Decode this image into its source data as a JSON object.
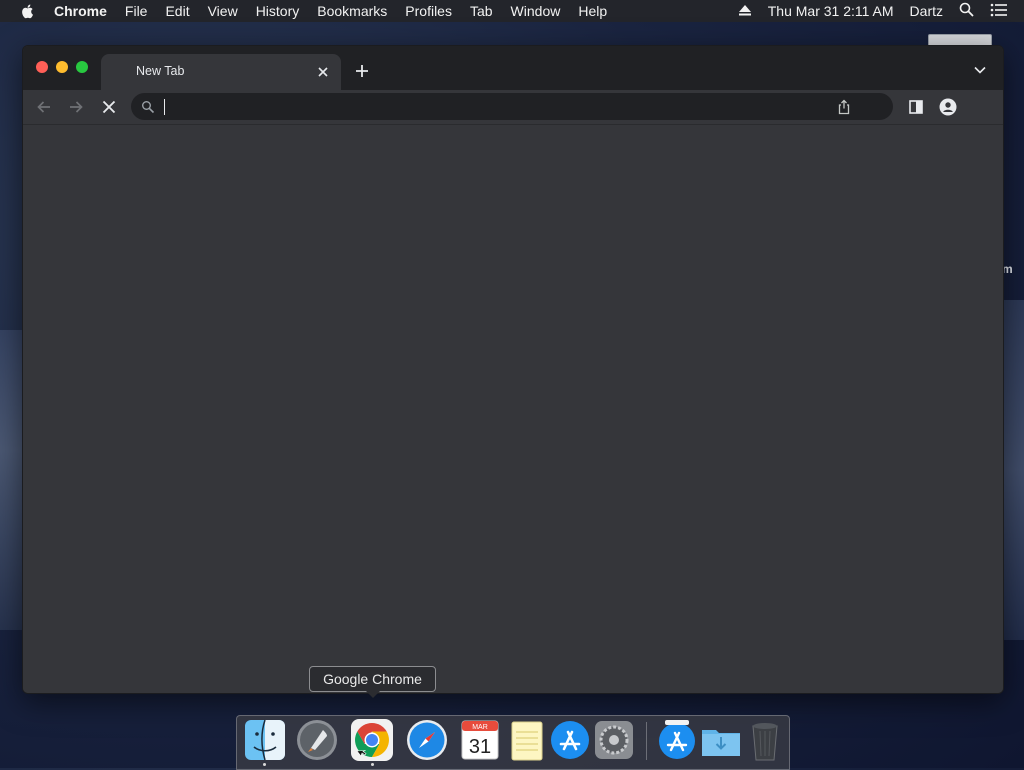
{
  "menubar": {
    "app_name": "Chrome",
    "items": [
      "File",
      "Edit",
      "View",
      "History",
      "Bookmarks",
      "Profiles",
      "Tab",
      "Window",
      "Help"
    ],
    "datetime": "Thu Mar 31  2:11 AM",
    "user": "Dartz",
    "icons": [
      "apple-icon",
      "eject-icon",
      "spotlight-search-icon",
      "notification-center-icon"
    ]
  },
  "desktop": {
    "partial_label": "m"
  },
  "browser": {
    "tab": {
      "title": "New Tab"
    },
    "omnibox": {
      "value": "",
      "placeholder": ""
    },
    "toolbar_icons": [
      "back-arrow-icon",
      "forward-arrow-icon",
      "stop-loading-icon",
      "search-icon",
      "share-icon",
      "side-panel-icon",
      "profile-icon"
    ],
    "colors": {
      "frame": "#202124",
      "toolbar": "#35363a",
      "text": "#e8eaed"
    }
  },
  "dock": {
    "tooltip": "Google Chrome",
    "calendar": {
      "month": "MAR",
      "day": "31"
    },
    "items": [
      "Finder",
      "Launchpad",
      "Google Chrome",
      "Safari",
      "Calendar",
      "Notes",
      "App Store",
      "System Preferences",
      "App Store Downloads",
      "Downloads",
      "Trash"
    ]
  }
}
